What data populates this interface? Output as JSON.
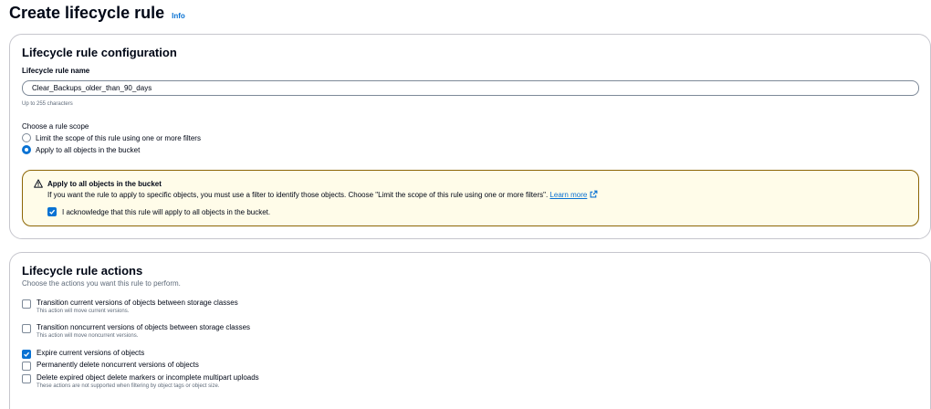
{
  "header": {
    "title": "Create lifecycle rule",
    "info_link": "Info"
  },
  "config": {
    "section_title": "Lifecycle rule configuration",
    "name_label": "Lifecycle rule name",
    "name_value": "Clear_Backups_older_than_90_days",
    "name_constraint": "Up to 255 characters",
    "scope_label": "Choose a rule scope",
    "scope_options": [
      {
        "label": "Limit the scope of this rule using one or more filters",
        "selected": false
      },
      {
        "label": "Apply to all objects in the bucket",
        "selected": true
      }
    ],
    "alert": {
      "icon": "warning-icon",
      "title": "Apply to all objects in the bucket",
      "body": "If you want the rule to apply to specific objects, you must use a filter to identify those objects. Choose \"Limit the scope of this rule using one or more filters\".",
      "link": "Learn more",
      "ack_label": "I acknowledge that this rule will apply to all objects in the bucket.",
      "ack_checked": true
    }
  },
  "actions": {
    "section_title": "Lifecycle rule actions",
    "subtitle": "Choose the actions you want this rule to perform.",
    "items": [
      {
        "label": "Transition current versions of objects between storage classes",
        "desc": "This action will move current versions.",
        "checked": false
      },
      {
        "label": "Transition noncurrent versions of objects between storage classes",
        "desc": "This action will move noncurrent versions.",
        "checked": false
      },
      {
        "label": "Expire current versions of objects",
        "desc": "",
        "checked": true
      },
      {
        "label": "Permanently delete noncurrent versions of objects",
        "desc": "",
        "checked": false
      },
      {
        "label": "Delete expired object delete markers or incomplete multipart uploads",
        "desc": "These actions are not supported when filtering by object tags or object size.",
        "checked": false
      }
    ]
  },
  "colors": {
    "accent": "#0972d3",
    "warning_border": "#8d6605",
    "warning_bg": "#fffce9"
  }
}
